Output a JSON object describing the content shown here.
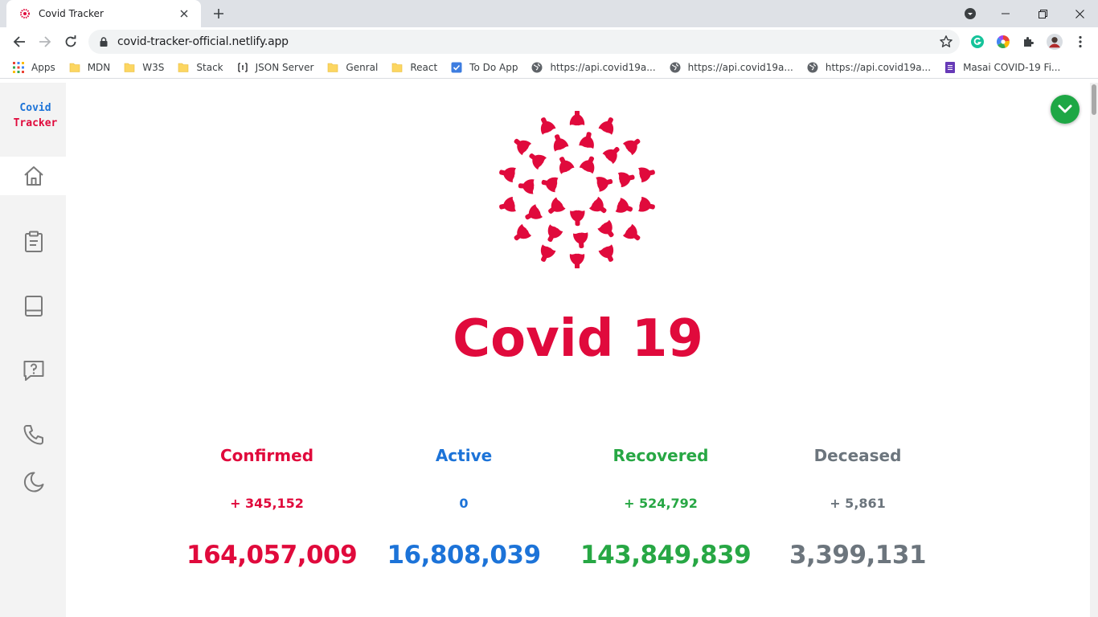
{
  "browser": {
    "tab_title": "Covid Tracker",
    "url": "covid-tracker-official.netlify.app",
    "bookmarks": [
      {
        "label": "Apps",
        "icon": "apps-grid-icon"
      },
      {
        "label": "MDN",
        "icon": "folder-icon"
      },
      {
        "label": "W3S",
        "icon": "folder-icon"
      },
      {
        "label": "Stack",
        "icon": "folder-icon"
      },
      {
        "label": "JSON Server",
        "icon": "json-server-icon"
      },
      {
        "label": "Genral",
        "icon": "folder-icon"
      },
      {
        "label": "React",
        "icon": "folder-icon"
      },
      {
        "label": "To Do App",
        "icon": "checkbox-icon"
      },
      {
        "label": "https://api.covid19a...",
        "icon": "globe-icon"
      },
      {
        "label": "https://api.covid19a...",
        "icon": "globe-icon"
      },
      {
        "label": "https://api.covid19a...",
        "icon": "globe-icon"
      },
      {
        "label": "Masai COVID-19 Fi...",
        "icon": "form-icon"
      }
    ]
  },
  "sidebar": {
    "brand_line1": "Covid",
    "brand_line2": "Tracker",
    "items": [
      "home-icon",
      "clipboard-icon",
      "book-icon",
      "help-message-icon",
      "phone-icon",
      "moon-icon"
    ]
  },
  "main": {
    "heading": "Covid 19",
    "stats": [
      {
        "label": "Confirmed",
        "delta": "+ 345,152",
        "total": "164,057,009",
        "color": "#e00a3c"
      },
      {
        "label": "Active",
        "delta": "0",
        "total": "16,808,039",
        "color": "#1c73d8"
      },
      {
        "label": "Recovered",
        "delta": "+ 524,792",
        "total": "143,849,839",
        "color": "#27a744"
      },
      {
        "label": "Deceased",
        "delta": "+ 5,861",
        "total": "3,399,131",
        "color": "#6c757d"
      }
    ]
  },
  "colors": {
    "accent_red": "#e00a3c",
    "toggle_green": "#1ea745",
    "sidebar_bg": "#f3f3f3"
  }
}
